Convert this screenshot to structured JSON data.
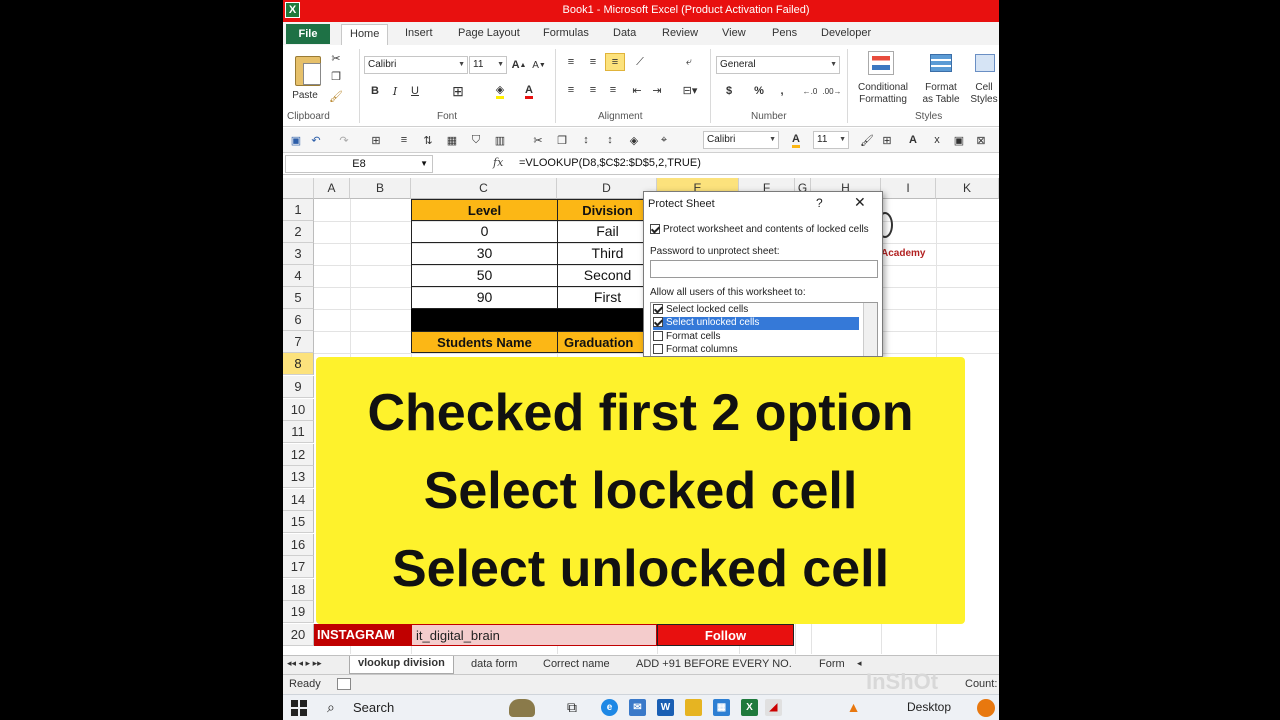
{
  "window": {
    "title": "Book1  -  Microsoft Excel (Product Activation Failed)",
    "app_letter": "X"
  },
  "ribbon_tabs": [
    "File",
    "Home",
    "Insert",
    "Page Layout",
    "Formulas",
    "Data",
    "Review",
    "View",
    "Pens",
    "Developer"
  ],
  "ribbon": {
    "paste_label": "Paste",
    "font_name": "Calibri",
    "font_size": "11",
    "number_format": "General",
    "groups": [
      "Clipboard",
      "Font",
      "Alignment",
      "Number",
      "Styles"
    ],
    "conditional_formatting": [
      "Conditional",
      "Formatting"
    ],
    "format_as_table": [
      "Format",
      "as Table"
    ],
    "cell_styles": [
      "Cell",
      "Styles"
    ],
    "bold": "B",
    "italic": "I",
    "underline": "U",
    "currency": "$",
    "percent": "%",
    "comma": ","
  },
  "quick_access": {
    "font_name": "Calibri",
    "font_size": "11"
  },
  "formula_bar": {
    "name_box": "E8",
    "fx": "fx",
    "formula": "=VLOOKUP(D8,$C$2:$D$5,2,TRUE)"
  },
  "columns": [
    "A",
    "B",
    "C",
    "D",
    "E",
    "F",
    "G",
    "H",
    "I",
    "K"
  ],
  "rows": [
    "1",
    "2",
    "3",
    "4",
    "5",
    "6",
    "7",
    "8",
    "9",
    "10",
    "11",
    "12",
    "13",
    "14",
    "15",
    "16",
    "17",
    "18",
    "19",
    "20"
  ],
  "lookup_table": {
    "headers": [
      "Level",
      "Division"
    ],
    "rows": [
      [
        "0",
        "Fail"
      ],
      [
        "30",
        "Third"
      ],
      [
        "50",
        "Second"
      ],
      [
        "90",
        "First"
      ]
    ]
  },
  "students_table": {
    "headers": [
      "Students Name",
      "Graduation"
    ]
  },
  "academy_text": "Academy",
  "instagram_row": {
    "label": "INSTAGRAM",
    "handle": "it_digital_brain",
    "action": "Follow"
  },
  "dialog": {
    "title": "Protect Sheet",
    "help": "?",
    "close": "✕",
    "protect_label": "Protect worksheet and contents of locked cells",
    "password_label": "Password to unprotect sheet:",
    "allow_label": "Allow all users of this worksheet to:",
    "options": [
      {
        "label": "Select locked cells",
        "checked": true
      },
      {
        "label": "Select unlocked cells",
        "checked": true
      },
      {
        "label": "Format cells",
        "checked": false
      },
      {
        "label": "Format columns",
        "checked": false
      }
    ]
  },
  "caption_lines": [
    "Checked first 2 option",
    "Select locked cell",
    "Select unlocked cell"
  ],
  "sheet_tabs": [
    "vlookup division",
    "data form",
    "Correct name",
    "ADD +91 BEFORE EVERY NO.",
    "Form"
  ],
  "status": {
    "ready": "Ready",
    "count": "Count:"
  },
  "taskbar": {
    "search": "Search",
    "desktop": "Desktop"
  },
  "watermark": "InShOt"
}
